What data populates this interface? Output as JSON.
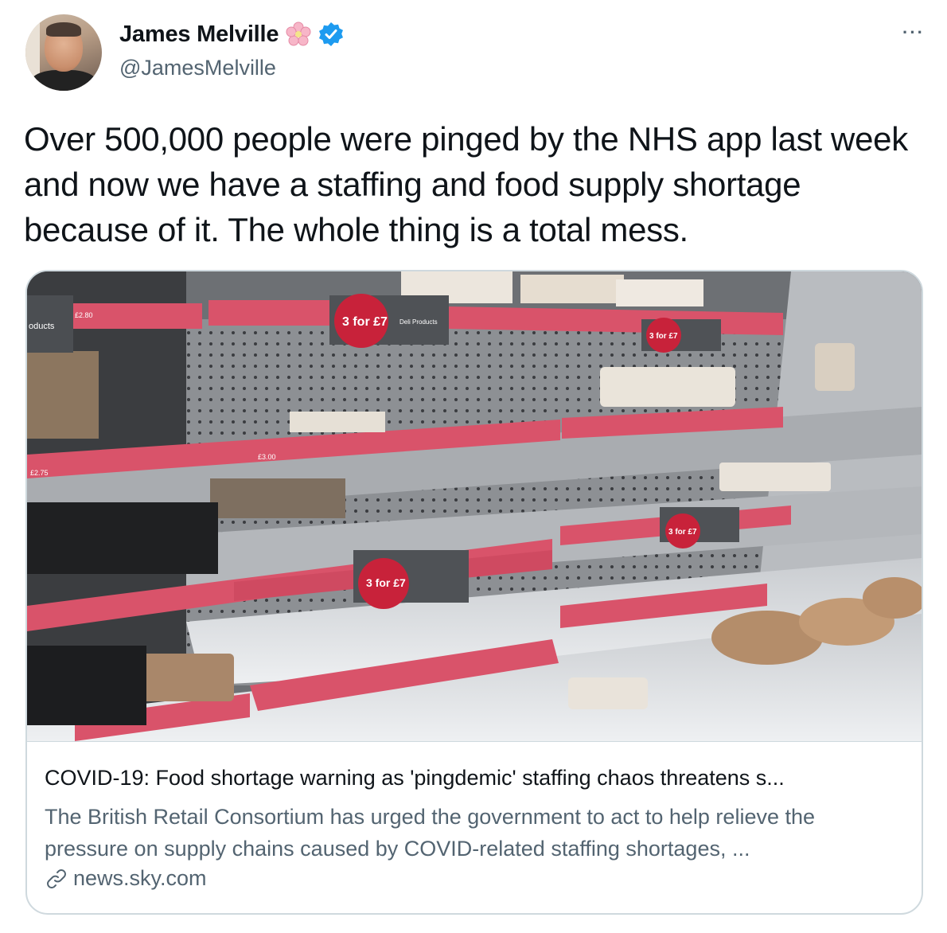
{
  "author": {
    "name": "James Melville",
    "handle": "@JamesMelville",
    "avatar_icon": "profile-photo",
    "name_emoji_icon": "cherry-blossom-icon",
    "verified_icon": "verified-badge-icon",
    "verified_color": "#1d9bf0"
  },
  "menu": {
    "icon": "more-options-icon",
    "label": "···"
  },
  "tweet": {
    "text": "Over 500,000 people were pinged by the NHS app last week and now we have a staffing and food supply shortage because of it. The whole thing is a total mess."
  },
  "link_card": {
    "image_description_icon": "supermarket-empty-shelves-photo",
    "title": "COVID-19: Food shortage warning as 'pingdemic' staffing chaos threatens s...",
    "description": "The British Retail Consortium has urged the government to act to help relieve the pressure on supply chains caused by COVID-related staffing shortages, ...",
    "domain": "news.sky.com",
    "domain_icon": "link-icon"
  },
  "photo_labels": {
    "promo_1": "3 for £7",
    "promo_2": "3 for £7",
    "promo_3": "3 for £7",
    "promo_4": "3 for £7",
    "deli": "Deli Products",
    "price_a": "£2.80",
    "price_b": "£2.75",
    "price_c": "£3.00",
    "side_label": "oducts"
  },
  "colors": {
    "text_primary": "#0f1419",
    "text_secondary": "#536471",
    "border": "#cfd9de",
    "shelf_label": "#d9536a",
    "promo_badge": "#c8223a"
  }
}
